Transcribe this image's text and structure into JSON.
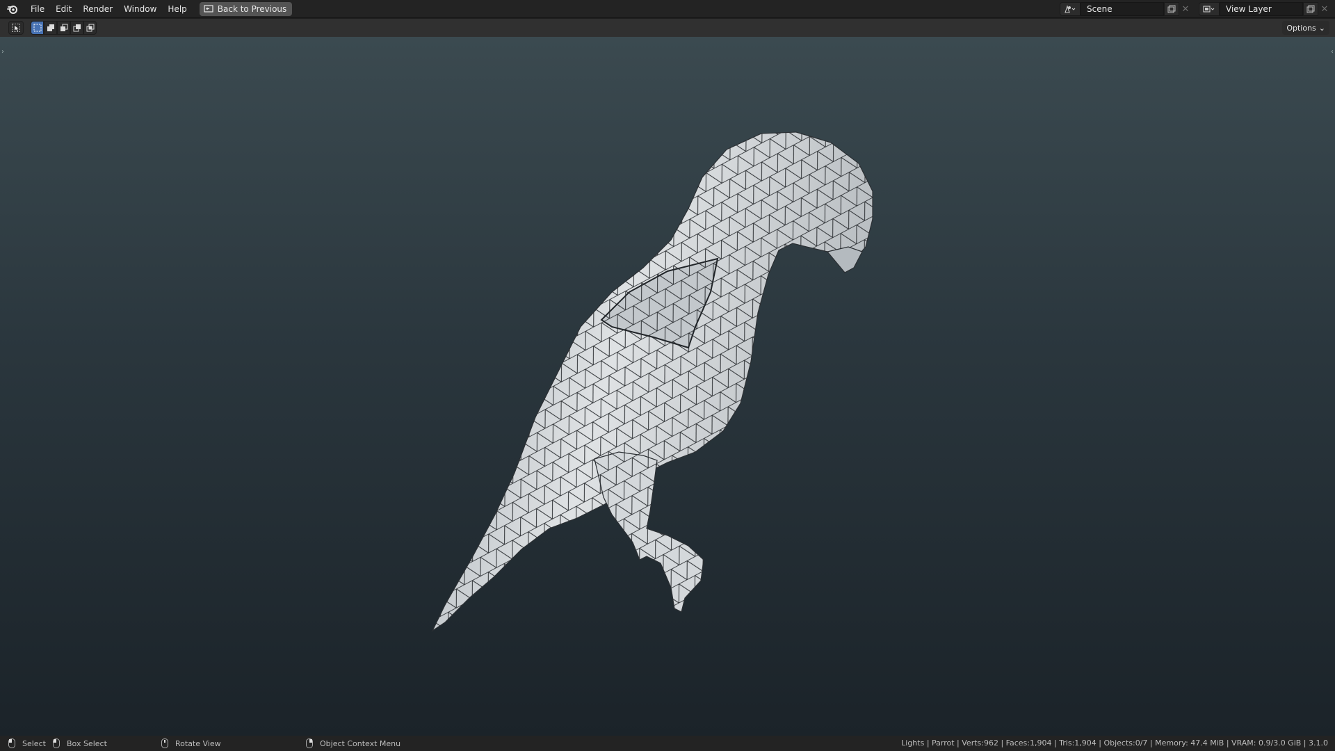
{
  "menu": [
    "File",
    "Edit",
    "Render",
    "Window",
    "Help"
  ],
  "back_button": "Back to Previous",
  "scene": {
    "value": "Scene"
  },
  "view_layer": {
    "value": "View Layer"
  },
  "options_label": "Options",
  "status": {
    "hints": [
      {
        "label": "Select",
        "icon": "mouse-left-icon"
      },
      {
        "label": "Box Select",
        "icon": "mouse-drag-icon"
      },
      {
        "label": "Rotate View",
        "icon": "mouse-middle-icon"
      },
      {
        "label": "Object Context Menu",
        "icon": "mouse-right-icon"
      }
    ],
    "info": "Lights | Parrot | Verts:962 | Faces:1,904 | Tris:1,904 | Objects:0/7 | Memory: 47.4 MiB | VRAM: 0.9/3.0 GiB | 3.1.0"
  },
  "colors": {
    "accent": "#4772b3",
    "mesh": "#d7dadc"
  }
}
